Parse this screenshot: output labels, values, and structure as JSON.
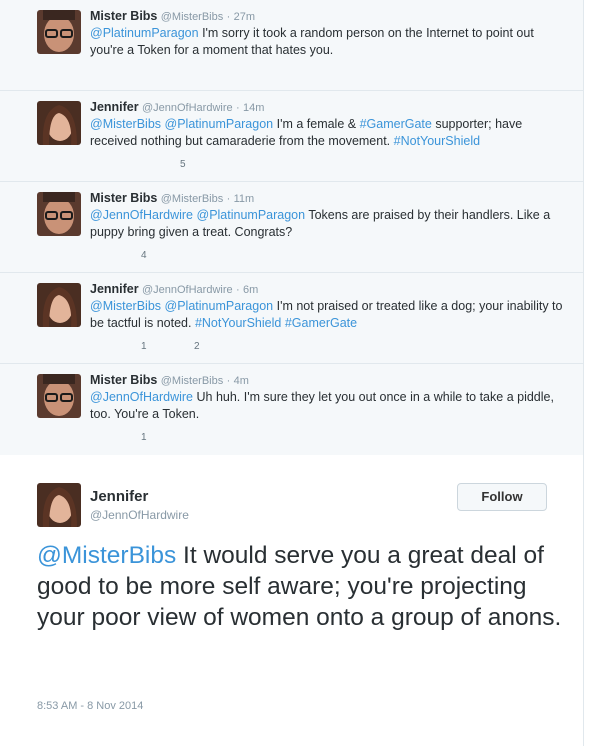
{
  "tweets": [
    {
      "name": "Mister Bibs",
      "handle": "@MisterBibs",
      "time": "27m",
      "mention": "@PlatinumParagon",
      "text": " I'm sorry it took a random person on the Internet to point out you're a Token for a moment that hates you."
    },
    {
      "name": "Jennifer",
      "handle": "@JennOfHardwire",
      "time": "14m",
      "mention": "@MisterBibs",
      "mention2": "@PlatinumParagon",
      "text_a": " I'm a female & ",
      "hashtag": "#GamerGate",
      "text_b": " supporter; have received nothing but camaraderie from the movement. ",
      "hashtag2": "#NotYourShield",
      "fav_count": "5"
    },
    {
      "name": "Mister Bibs",
      "handle": "@MisterBibs",
      "time": "11m",
      "mention": "@JennOfHardwire",
      "mention2": "@PlatinumParagon",
      "text": " Tokens are praised by their handlers. Like a puppy bring given a treat. Congrats?",
      "fav_count": "4"
    },
    {
      "name": "Jennifer",
      "handle": "@JennOfHardwire",
      "time": "6m",
      "mention": "@MisterBibs",
      "mention2": "@PlatinumParagon",
      "text": " I'm not praised or treated like a dog; your inability to be tactful is noted. ",
      "hashtag": "#NotYourShield",
      "hashtag2": "#GamerGate",
      "rt_count": "1",
      "fav_count": "2"
    },
    {
      "name": "Mister Bibs",
      "handle": "@MisterBibs",
      "time": "4m",
      "mention": "@JennOfHardwire",
      "text": " Uh huh. I'm sure they let you out once in a while to take a piddle, too. You're a Token.",
      "rt_count": "1"
    }
  ],
  "focus": {
    "name": "Jennifer",
    "handle": "@JennOfHardwire",
    "follow_label": "Follow",
    "mention": "@MisterBibs",
    "text": " It would serve you a great deal of good to be more self aware; you're projecting your poor view of women onto a group of anons.",
    "timestamp": "8:53 AM - 8 Nov 2014"
  },
  "dot": "·",
  "colors": {
    "link": "#3b94d9",
    "stream_bg": "#f5f8fa",
    "muted": "#8899a6"
  }
}
